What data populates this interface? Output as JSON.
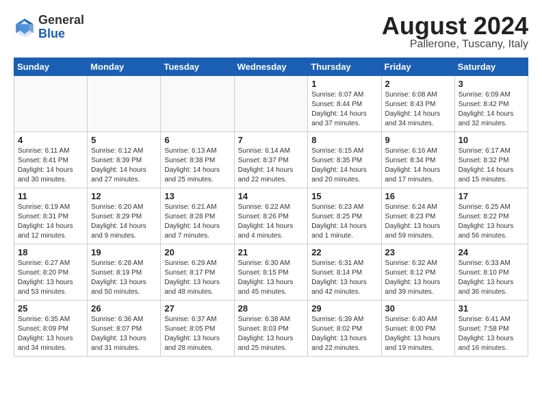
{
  "logo": {
    "general": "General",
    "blue": "Blue"
  },
  "title": "August 2024",
  "location": "Pallerone, Tuscany, Italy",
  "headers": [
    "Sunday",
    "Monday",
    "Tuesday",
    "Wednesday",
    "Thursday",
    "Friday",
    "Saturday"
  ],
  "weeks": [
    [
      {
        "day": "",
        "info": ""
      },
      {
        "day": "",
        "info": ""
      },
      {
        "day": "",
        "info": ""
      },
      {
        "day": "",
        "info": ""
      },
      {
        "day": "1",
        "info": "Sunrise: 6:07 AM\nSunset: 8:44 PM\nDaylight: 14 hours\nand 37 minutes."
      },
      {
        "day": "2",
        "info": "Sunrise: 6:08 AM\nSunset: 8:43 PM\nDaylight: 14 hours\nand 34 minutes."
      },
      {
        "day": "3",
        "info": "Sunrise: 6:09 AM\nSunset: 8:42 PM\nDaylight: 14 hours\nand 32 minutes."
      }
    ],
    [
      {
        "day": "4",
        "info": "Sunrise: 6:11 AM\nSunset: 8:41 PM\nDaylight: 14 hours\nand 30 minutes."
      },
      {
        "day": "5",
        "info": "Sunrise: 6:12 AM\nSunset: 8:39 PM\nDaylight: 14 hours\nand 27 minutes."
      },
      {
        "day": "6",
        "info": "Sunrise: 6:13 AM\nSunset: 8:38 PM\nDaylight: 14 hours\nand 25 minutes."
      },
      {
        "day": "7",
        "info": "Sunrise: 6:14 AM\nSunset: 8:37 PM\nDaylight: 14 hours\nand 22 minutes."
      },
      {
        "day": "8",
        "info": "Sunrise: 6:15 AM\nSunset: 8:35 PM\nDaylight: 14 hours\nand 20 minutes."
      },
      {
        "day": "9",
        "info": "Sunrise: 6:16 AM\nSunset: 8:34 PM\nDaylight: 14 hours\nand 17 minutes."
      },
      {
        "day": "10",
        "info": "Sunrise: 6:17 AM\nSunset: 8:32 PM\nDaylight: 14 hours\nand 15 minutes."
      }
    ],
    [
      {
        "day": "11",
        "info": "Sunrise: 6:19 AM\nSunset: 8:31 PM\nDaylight: 14 hours\nand 12 minutes."
      },
      {
        "day": "12",
        "info": "Sunrise: 6:20 AM\nSunset: 8:29 PM\nDaylight: 14 hours\nand 9 minutes."
      },
      {
        "day": "13",
        "info": "Sunrise: 6:21 AM\nSunset: 8:28 PM\nDaylight: 14 hours\nand 7 minutes."
      },
      {
        "day": "14",
        "info": "Sunrise: 6:22 AM\nSunset: 8:26 PM\nDaylight: 14 hours\nand 4 minutes."
      },
      {
        "day": "15",
        "info": "Sunrise: 6:23 AM\nSunset: 8:25 PM\nDaylight: 14 hours\nand 1 minute."
      },
      {
        "day": "16",
        "info": "Sunrise: 6:24 AM\nSunset: 8:23 PM\nDaylight: 13 hours\nand 59 minutes."
      },
      {
        "day": "17",
        "info": "Sunrise: 6:25 AM\nSunset: 8:22 PM\nDaylight: 13 hours\nand 56 minutes."
      }
    ],
    [
      {
        "day": "18",
        "info": "Sunrise: 6:27 AM\nSunset: 8:20 PM\nDaylight: 13 hours\nand 53 minutes."
      },
      {
        "day": "19",
        "info": "Sunrise: 6:28 AM\nSunset: 8:19 PM\nDaylight: 13 hours\nand 50 minutes."
      },
      {
        "day": "20",
        "info": "Sunrise: 6:29 AM\nSunset: 8:17 PM\nDaylight: 13 hours\nand 48 minutes."
      },
      {
        "day": "21",
        "info": "Sunrise: 6:30 AM\nSunset: 8:15 PM\nDaylight: 13 hours\nand 45 minutes."
      },
      {
        "day": "22",
        "info": "Sunrise: 6:31 AM\nSunset: 8:14 PM\nDaylight: 13 hours\nand 42 minutes."
      },
      {
        "day": "23",
        "info": "Sunrise: 6:32 AM\nSunset: 8:12 PM\nDaylight: 13 hours\nand 39 minutes."
      },
      {
        "day": "24",
        "info": "Sunrise: 6:33 AM\nSunset: 8:10 PM\nDaylight: 13 hours\nand 36 minutes."
      }
    ],
    [
      {
        "day": "25",
        "info": "Sunrise: 6:35 AM\nSunset: 8:09 PM\nDaylight: 13 hours\nand 34 minutes."
      },
      {
        "day": "26",
        "info": "Sunrise: 6:36 AM\nSunset: 8:07 PM\nDaylight: 13 hours\nand 31 minutes."
      },
      {
        "day": "27",
        "info": "Sunrise: 6:37 AM\nSunset: 8:05 PM\nDaylight: 13 hours\nand 28 minutes."
      },
      {
        "day": "28",
        "info": "Sunrise: 6:38 AM\nSunset: 8:03 PM\nDaylight: 13 hours\nand 25 minutes."
      },
      {
        "day": "29",
        "info": "Sunrise: 6:39 AM\nSunset: 8:02 PM\nDaylight: 13 hours\nand 22 minutes."
      },
      {
        "day": "30",
        "info": "Sunrise: 6:40 AM\nSunset: 8:00 PM\nDaylight: 13 hours\nand 19 minutes."
      },
      {
        "day": "31",
        "info": "Sunrise: 6:41 AM\nSunset: 7:58 PM\nDaylight: 13 hours\nand 16 minutes."
      }
    ]
  ]
}
